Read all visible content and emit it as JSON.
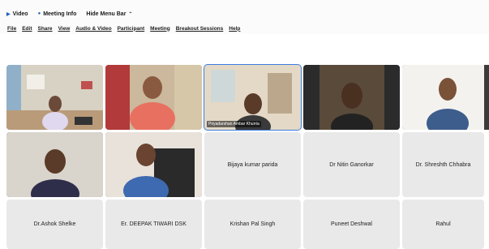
{
  "topbar": {
    "video_label": "Video",
    "meeting_info_label": "Meeting Info",
    "hide_menu_bar_label": "Hide Menu Bar"
  },
  "menu": {
    "items": [
      "File",
      "Edit",
      "Share",
      "View",
      "Audio & Video",
      "Participant",
      "Meeting",
      "Breakout Sessions",
      "Help"
    ]
  },
  "participants": {
    "row1": [
      {
        "name": "",
        "type": "video"
      },
      {
        "name": "",
        "type": "video"
      },
      {
        "name": "Priyadarshan Ambar Khurria",
        "type": "video",
        "active": true
      },
      {
        "name": "",
        "type": "video"
      },
      {
        "name": "",
        "type": "video"
      }
    ],
    "row2": [
      {
        "name": "",
        "type": "video"
      },
      {
        "name": "",
        "type": "video"
      },
      {
        "name": "Bijaya kumar parida",
        "type": "placeholder"
      },
      {
        "name": "Dr Nitin Ganorkar",
        "type": "placeholder"
      },
      {
        "name": "Dr. Shreshth Chhabra",
        "type": "placeholder"
      }
    ],
    "row3": [
      {
        "name": "Dr.Ashok Shelke",
        "type": "placeholder"
      },
      {
        "name": "Er. DEEPAK TIWARI DSK",
        "type": "placeholder"
      },
      {
        "name": "Krishan Pal Singh",
        "type": "placeholder"
      },
      {
        "name": "Puneet Deshwal",
        "type": "placeholder"
      },
      {
        "name": "Rahul",
        "type": "placeholder"
      }
    ]
  },
  "colors": {
    "accent": "#3a7de1",
    "tile_bg": "#e9e9e9",
    "video_bg": "#3b3b3b"
  }
}
